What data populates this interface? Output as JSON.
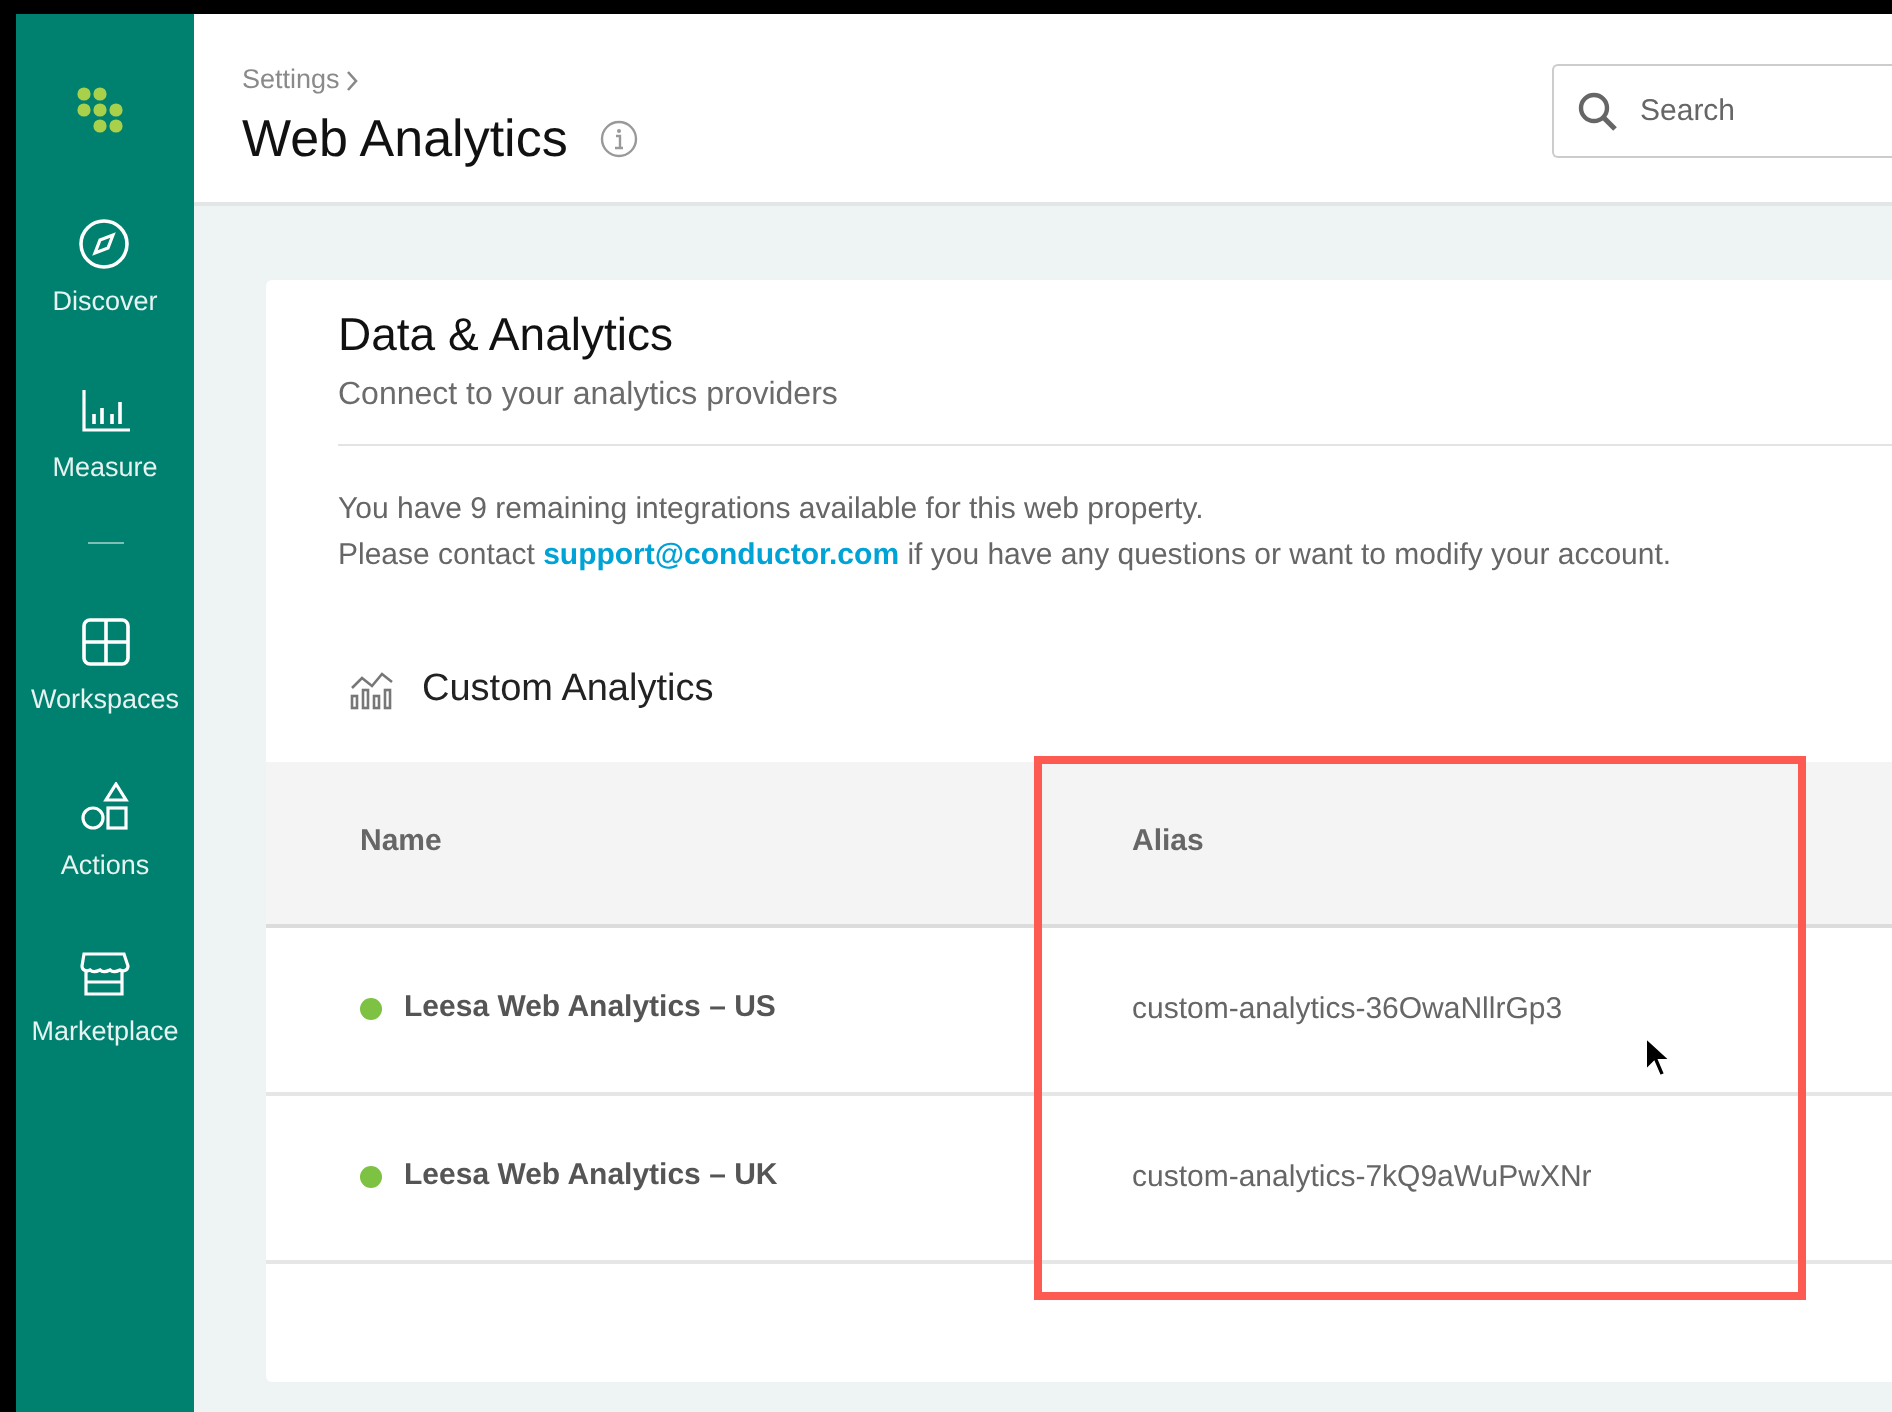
{
  "sidebar": {
    "groups": [
      [
        {
          "label": "Discover",
          "kind": "compass"
        },
        {
          "label": "Measure",
          "kind": "bars"
        }
      ],
      [
        {
          "label": "Workspaces",
          "kind": "grid"
        },
        {
          "label": "Actions",
          "kind": "shapes"
        },
        {
          "label": "Marketplace",
          "kind": "store"
        }
      ]
    ]
  },
  "header": {
    "breadcrumb": "Settings",
    "title": "Web Analytics",
    "search": {
      "placeholder": "Search"
    }
  },
  "card": {
    "title": "Data & Analytics",
    "subtitle": "Connect to your analytics providers",
    "notice": {
      "line_1": "You have 9 remaining integrations available for this web property.",
      "line_2_before": "Please contact",
      "link": "support@conductor.com",
      "line_2_after": "if you have any questions or want to modify your account."
    },
    "section": {
      "title": "Custom Analytics"
    },
    "table": {
      "columns": [
        "Name",
        "Alias"
      ],
      "rows": [
        {
          "name": "Leesa Web Analytics – US",
          "alias": "custom-analytics-36OwaNllrGp3",
          "color": "#7dc242"
        },
        {
          "name": "Leesa Web Analytics – UK",
          "alias": "custom-analytics-7kQ9aWuPwXNr",
          "color": "#7dc242"
        }
      ]
    }
  }
}
